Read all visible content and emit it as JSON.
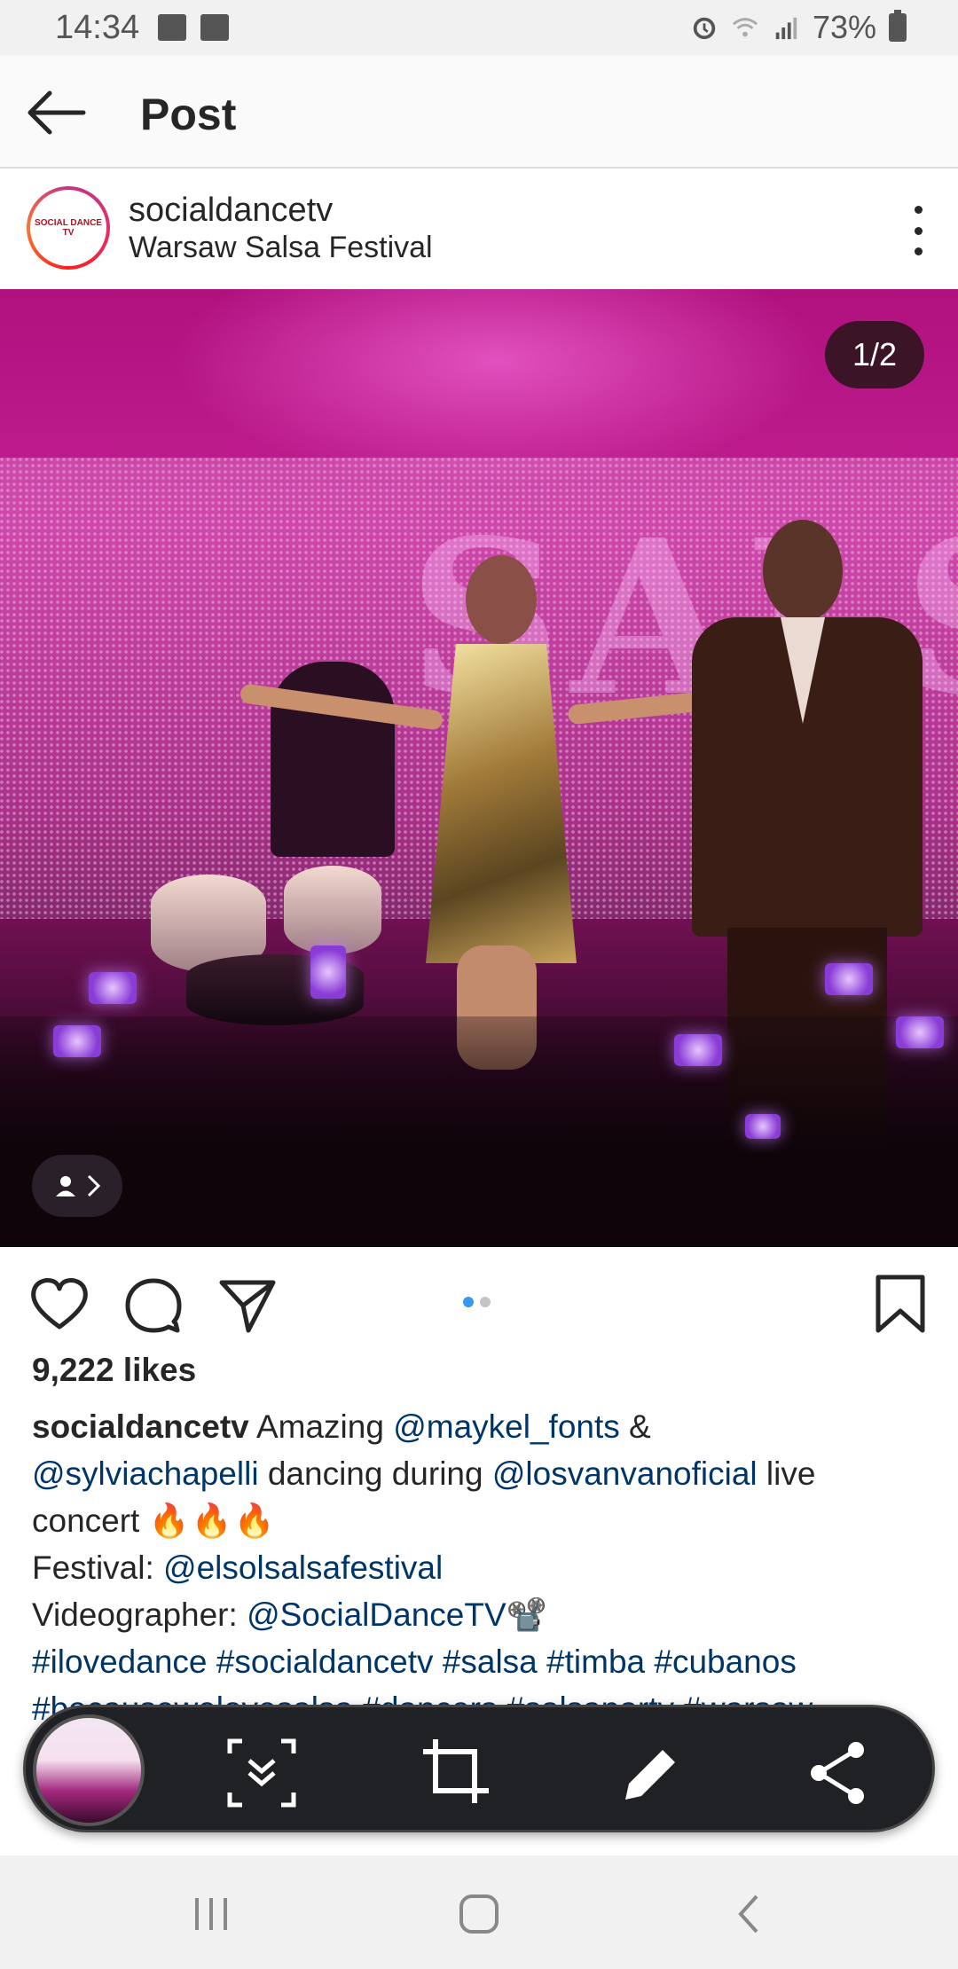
{
  "status_bar": {
    "time": "14:34",
    "battery": "73%",
    "icons": [
      "image-icon",
      "mail-icon",
      "alarm-icon",
      "wifi-icon",
      "signal-icon",
      "battery-icon"
    ]
  },
  "header": {
    "title": "Post",
    "back_icon": "arrow-left-icon"
  },
  "post": {
    "username": "socialdancetv",
    "location": "Warsaw Salsa Festival",
    "avatar_text": "SOCIAL DANCE TV",
    "media_counter": "1/2",
    "stage_text": "SALSA",
    "carousel": {
      "count": 2,
      "active_index": 0
    },
    "likes": "9,222 likes",
    "caption": {
      "user": "socialdancetv",
      "segments": {
        "text1": " Amazing ",
        "mention1": "@maykel_fonts",
        "text2": " & ",
        "mention2": "@sylviachapelli",
        "text3": " dancing during ",
        "mention3": "@losvanvanoficial",
        "text4": " live concert ",
        "fires": "🔥🔥🔥",
        "festival_label": "Festival: ",
        "festival_mention": "@elsolsalsafestival",
        "videographer_label": "Videographer: ",
        "videographer_mention": "@SocialDanceTV",
        "camera": "📽️"
      },
      "hashtags_line1": "#ilovedance #socialdancetv #salsa #timba #cubanos",
      "hashtags_line2": "#becausewelovesalsa #dancers #salsaparty #warsaw"
    }
  },
  "actions": {
    "icons": [
      "heart-icon",
      "comment-icon",
      "share-icon",
      "bookmark-icon"
    ]
  },
  "capture_toolbar": {
    "icons": [
      "scroll-capture-icon",
      "crop-icon",
      "edit-icon",
      "share-icon"
    ]
  },
  "nav_bar": {
    "icons": [
      "recents-icon",
      "home-icon",
      "back-icon"
    ]
  },
  "colors": {
    "mention": "#003569",
    "carousel_active": "#3897f0",
    "text": "#262626"
  }
}
